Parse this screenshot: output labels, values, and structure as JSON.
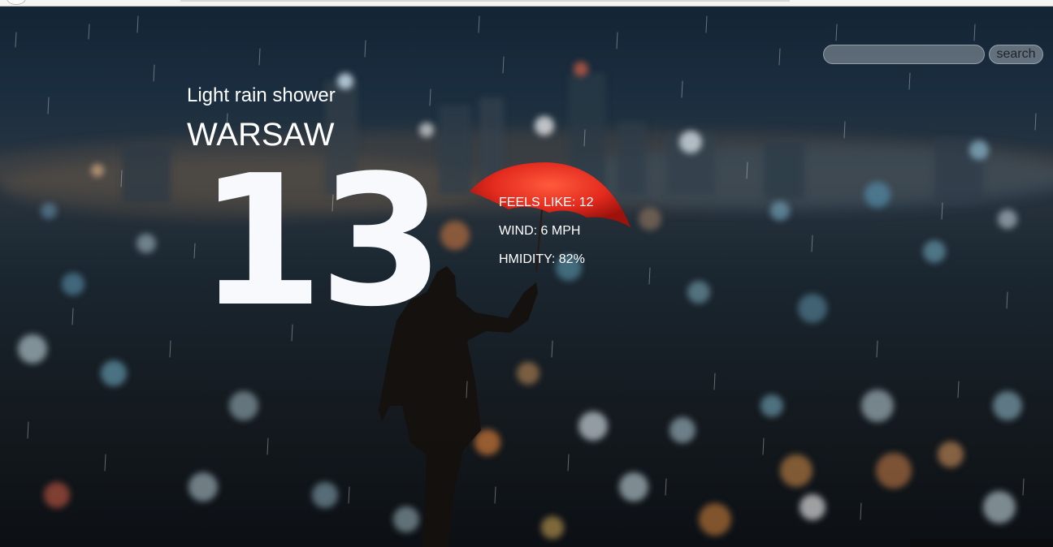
{
  "weather": {
    "condition": "Light rain shower",
    "city": "WARSAW",
    "temperature": "13",
    "feels_like": "FEELS LIKE: 12",
    "wind": "WIND: 6 MPH",
    "humidity": "HMIDITY: 82%"
  },
  "search": {
    "placeholder": "",
    "value": "",
    "button_label": "search"
  },
  "colors": {
    "umbrella": "#e32a1e",
    "text": "#ffffff",
    "sky": "#0c1622"
  }
}
